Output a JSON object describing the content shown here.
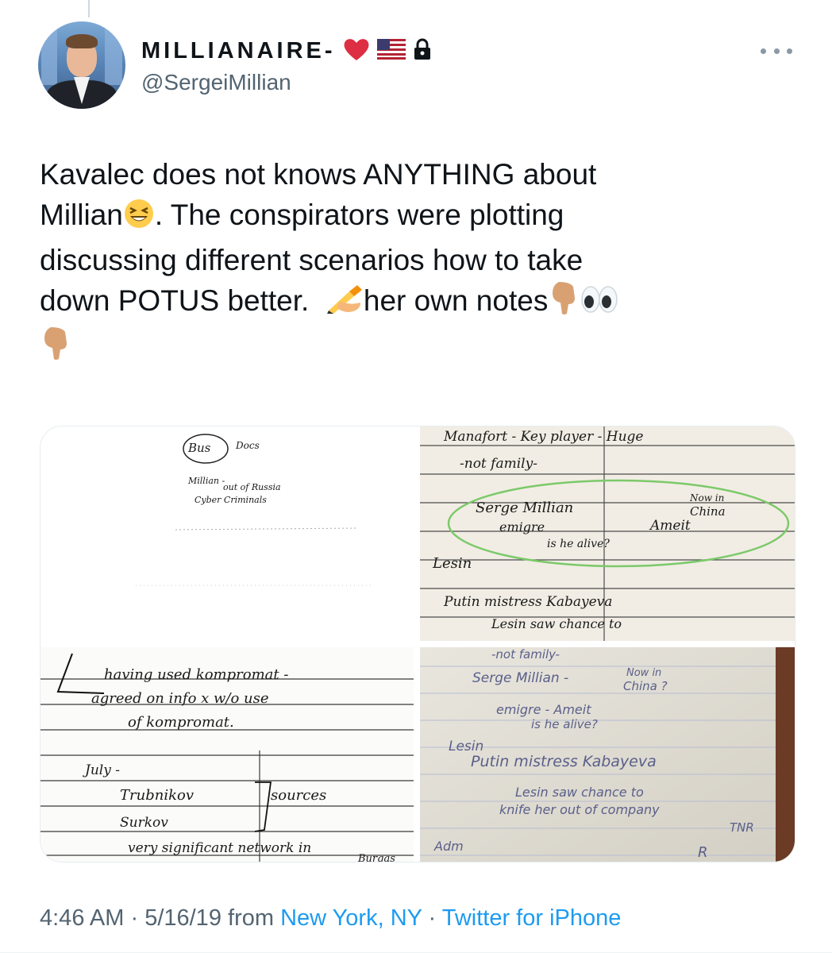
{
  "tweet": {
    "author": {
      "display_name": "MILLIANAIRE-",
      "name_icons": [
        "red-heart-emoji",
        "us-flag-emoji",
        "lock-icon"
      ],
      "handle": "@SergeiMillian"
    },
    "text": {
      "line1": "Kavalec does not knows ANYTHING about",
      "line2a": "Millian",
      "line2b": ". The conspirators were plotting",
      "line3": "discussing different scenarios how to take",
      "line4a": "down POTUS better.  ",
      "line4b": "her own notes"
    },
    "media": {
      "note1": {
        "lines": [
          "Bus",
          "Docs",
          "Millian -",
          "out of Russia",
          "Cyber Criminals"
        ]
      },
      "note2": {
        "lines": [
          "Manafort - Key player - Huge",
          "-not family-",
          "Serge Millian",
          "Now in",
          "China",
          "emigre",
          "Ameit",
          "is he alive?",
          "Lesin",
          "Putin mistress Kabayeva",
          "Lesin saw chance to"
        ]
      },
      "note3": {
        "lines": [
          "having used kompromat -",
          "agreed on info x w/o use",
          "of kompromat.",
          "July -",
          "Trubnikov",
          "sources",
          "Surkov",
          "very significant network in",
          "Burgas"
        ]
      },
      "note4": {
        "lines": [
          "-not family-",
          "Serge Millian -",
          "Now in",
          "China ?",
          "emigre - Ameit",
          "is he alive?",
          "Lesin",
          "Putin mistress Kabayeva",
          "Lesin saw chance to",
          "knife her out of company",
          "TNR",
          "Adm",
          "R"
        ]
      }
    },
    "meta": {
      "time": "4:46 AM",
      "sep1": " · ",
      "date": "5/16/19",
      "from": " from ",
      "location": "New York, NY",
      "sep2": " · ",
      "client": "Twitter for iPhone"
    }
  },
  "colors": {
    "text": "#0f1419",
    "secondary": "#536471",
    "link": "#1d9bf0",
    "circle_marker": "#7cc96a"
  }
}
